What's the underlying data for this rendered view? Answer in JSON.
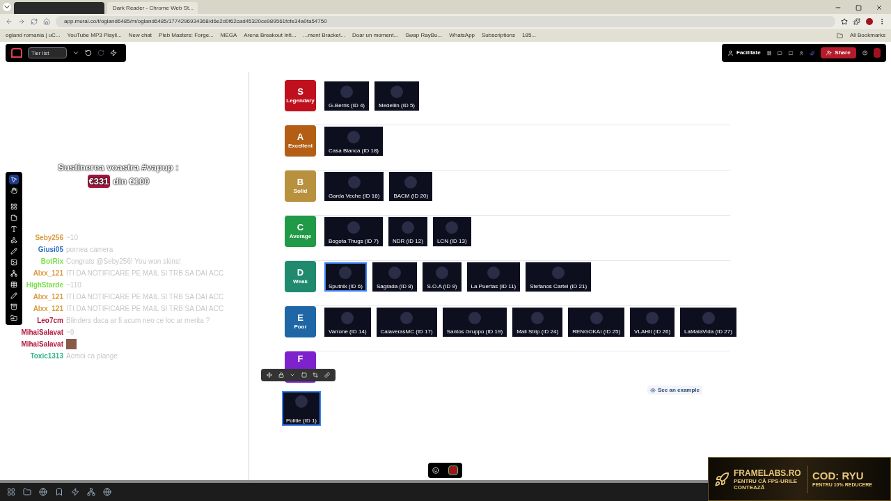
{
  "browser": {
    "tabs": [
      {
        "selected": true
      },
      {
        "title": "Dark Reader - Chrome Web St...",
        "selected": false
      }
    ],
    "url": "app.mural.co/t/ogland6485/m/ogland6485/1774296934368/d6e2d0f62cad45320ce989561fcfe34a0fa54750",
    "bookmarks": [
      "ogland romania | uC...",
      "YouTube MP3 Playli...",
      "New chat",
      "Pleb Masters: Forge...",
      "MEGA",
      "Arena Breakout Infi...",
      "...ment Bracket...",
      "Doar un moment...",
      "Swap RayBu...",
      "WhatsApp",
      "Subscriptions",
      "185..."
    ],
    "all_bookmarks": "All Bookmarks"
  },
  "mural": {
    "board_title": "Tier list",
    "facilitate": "Facilitate",
    "share": "Share",
    "see_example": "See an example"
  },
  "stream_overlay": {
    "goal_title": "Sustinerea voastra #vapup :",
    "goal_amount": "€331",
    "goal_rest": "din €100"
  },
  "chat": [
    {
      "user": "Seby256",
      "color": "#d99a3c",
      "kind": "text",
      "message": "~10"
    },
    {
      "user": "Giusi05",
      "color": "#2f6fc0",
      "kind": "text",
      "message": "pornea camera"
    },
    {
      "user": "BotRix",
      "color": "#7be04a",
      "kind": "text",
      "message": "Congrats @Seby256! You won skins!"
    },
    {
      "user": "Alxx_121",
      "color": "#d99a3c",
      "kind": "text",
      "message": "ITI DA NOTIFICARE PE MAIL SI TRB SA DAI ACC"
    },
    {
      "user": "HighStarde",
      "color": "#7be04a",
      "kind": "text",
      "message": "~110"
    },
    {
      "user": "Alxx_121",
      "color": "#d99a3c",
      "kind": "text",
      "message": "ITI DA NOTIFICARE PE MAIL SI TRB SA DAI ACC"
    },
    {
      "user": "Alxx_121",
      "color": "#d99a3c",
      "kind": "text",
      "message": "ITI DA NOTIFICARE PE MAIL SI TRB SA DAI ACC"
    },
    {
      "user": "Leo7cm",
      "color": "#b0173d",
      "kind": "text",
      "message": "Blinders daca ar fi acum neo ce loc ar merita ?"
    },
    {
      "user": "MihaiSalavat",
      "color": "#b0173d",
      "kind": "text",
      "message": "~9"
    },
    {
      "user": "MihaiSalavat",
      "color": "#b0173d",
      "kind": "emote"
    },
    {
      "user": "Toxic1313",
      "color": "#2fb38a",
      "kind": "text",
      "message": "Acmoi ca plange"
    }
  ],
  "tiers": [
    {
      "letter": "S",
      "label": "Legendary",
      "color": "#c0101e",
      "items": [
        {
          "name": "G-Berris (ID 4)",
          "selected": false
        },
        {
          "name": "Medellin (ID 5)",
          "selected": false
        }
      ]
    },
    {
      "letter": "A",
      "label": "Excellent",
      "color": "#b35e14",
      "items": [
        {
          "name": "Casa Blanca (ID 18)",
          "selected": false
        }
      ]
    },
    {
      "letter": "B",
      "label": "Solid",
      "color": "#b8913f",
      "items": [
        {
          "name": "Garda Veche (ID 16)",
          "selected": false
        },
        {
          "name": "BACM (ID 20)",
          "selected": false
        }
      ]
    },
    {
      "letter": "C",
      "label": "Average",
      "color": "#219a48",
      "items": [
        {
          "name": "Bogota Thugs (ID 7)",
          "selected": false
        },
        {
          "name": "NDR (ID 12)",
          "selected": false
        },
        {
          "name": "LCN (ID 13)",
          "selected": false
        }
      ]
    },
    {
      "letter": "D",
      "label": "Weak",
      "color": "#1f8a6e",
      "items": [
        {
          "name": "Sputnik (ID 6)",
          "selected": true
        },
        {
          "name": "Sagrada (ID 8)",
          "selected": false
        },
        {
          "name": "S.O.A (ID 9)",
          "selected": false
        },
        {
          "name": "La Puertas (ID 11)",
          "selected": false
        },
        {
          "name": "Stefanos Cartel (ID 21)",
          "selected": false
        }
      ]
    },
    {
      "letter": "E",
      "label": "Poor",
      "color": "#1f66a6",
      "items": [
        {
          "name": "Varrone (ID 14)",
          "selected": false
        },
        {
          "name": "CalaverasMC (ID 17)",
          "selected": false
        },
        {
          "name": "Santos Gruppo (ID 19)",
          "selected": false
        },
        {
          "name": "Mali Strip (ID 24)",
          "selected": false
        },
        {
          "name": "RENGOKAI (ID 25)",
          "selected": false
        },
        {
          "name": "VLAHII (ID 26)",
          "selected": false
        },
        {
          "name": "LaMalaVida (ID 27)",
          "selected": false
        }
      ]
    },
    {
      "letter": "F",
      "color": "#7e22ce"
    }
  ],
  "loose_item": {
    "name": "Politie (ID 1)",
    "selected": true
  },
  "ad": {
    "brand": "FRAMELABS.RO",
    "tagline": "PENTRU CĂ FPS-URILE CONTEAZĂ",
    "code": "COD: RYU",
    "offer": "PENTRU 10% REDUCERE"
  }
}
